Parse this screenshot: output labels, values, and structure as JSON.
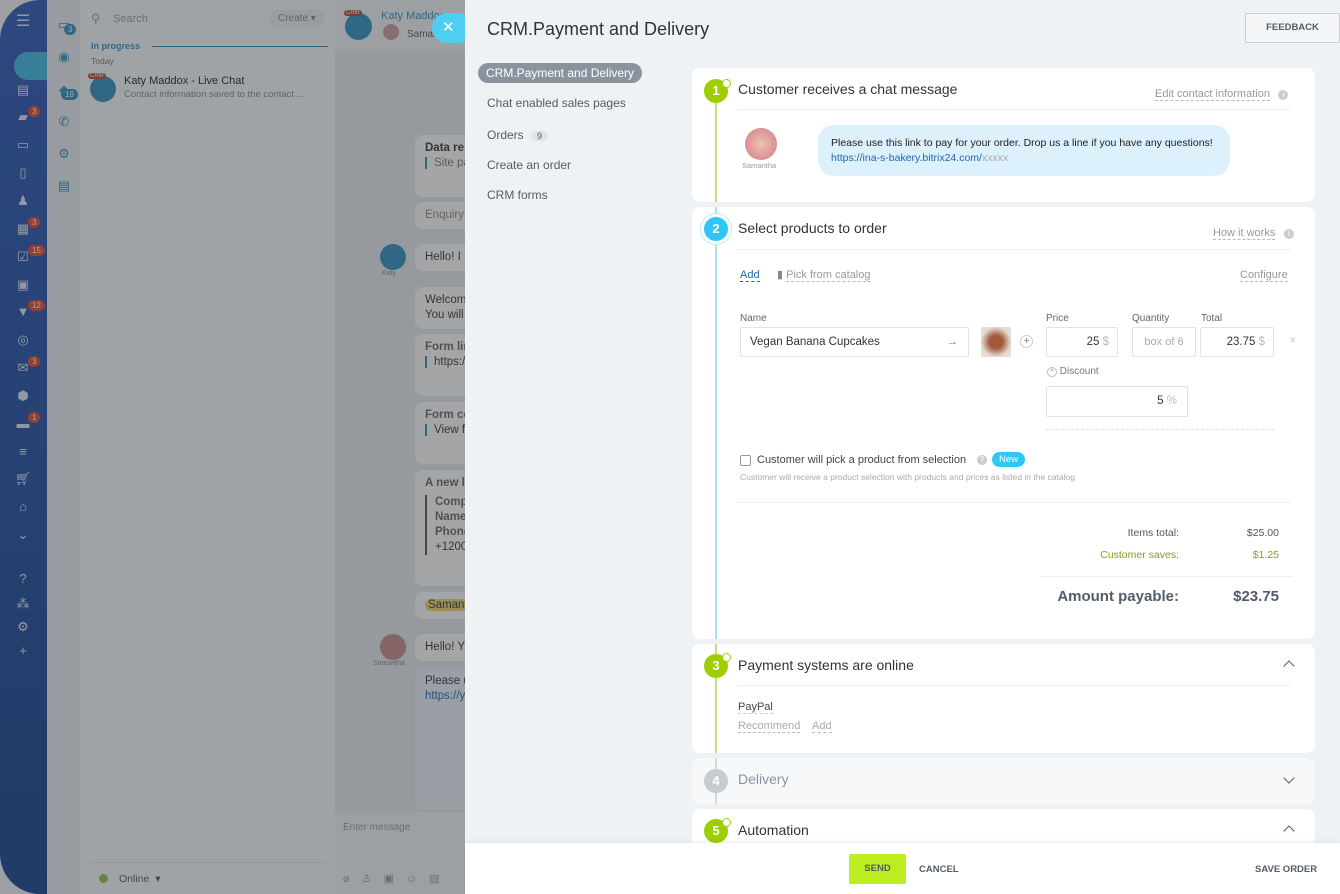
{
  "nav": {
    "badges": {
      "chat": "3",
      "calendar": "3",
      "tasks": "15",
      "crm": "12",
      "mail": "3",
      "robots": "1"
    }
  },
  "strip": {
    "badges": {
      "messages": "3",
      "openlines": "19"
    }
  },
  "list": {
    "search_placeholder": "Search",
    "create_label": "Create",
    "section": "In progress",
    "day": "Today",
    "items": [
      {
        "tag": "CRM",
        "title": "Katy Maddox - Live Chat",
        "preview": "Contact information saved to the contact ..."
      }
    ],
    "status": "Online"
  },
  "chat": {
    "tag": "CRM",
    "title": "Katy Maddox",
    "subtitle": "Samantha",
    "input_placeholder": "Enter message",
    "messages": [
      "Data re",
      "Site pa",
      "Enquiry",
      "Hello! I",
      "Welcom",
      "You will",
      "Form lin",
      "https:/",
      "Form co",
      "View f",
      "A new l",
      "Compl",
      "Name",
      "Phone",
      "+1200",
      "Saman",
      "Hello! Y",
      "Please u",
      "https://y"
    ],
    "avatars": {
      "katy": "Katy",
      "samantha": "Samantha"
    }
  },
  "panel": {
    "title": "CRM.Payment and Delivery",
    "feedback": "FEEDBACK",
    "menu": [
      {
        "label": "CRM.Payment and Delivery",
        "active": true
      },
      {
        "label": "Chat enabled sales pages"
      },
      {
        "label": "Orders",
        "count": "9"
      },
      {
        "label": "Create an order"
      },
      {
        "label": "CRM forms"
      }
    ],
    "step1": {
      "num": "1",
      "title": "Customer receives a chat message",
      "action": "Edit contact information",
      "sender": "Samantha",
      "message": "Please use this link to pay for your order. Drop us a line if you have any questions! ",
      "link": "https://ina-s-bakery.bitrix24.com/",
      "link_suffix": "xxxxx"
    },
    "step2": {
      "num": "2",
      "title": "Select products to order",
      "action": "How it works",
      "add": "Add",
      "catalog": "Pick from catalog",
      "configure": "Configure",
      "headers": {
        "name": "Name",
        "price": "Price",
        "quantity": "Quantity",
        "total": "Total"
      },
      "product": {
        "name": "Vegan Banana Cupcakes",
        "price": "25",
        "currency": "$",
        "quantity": "box of 6",
        "total": "23.75"
      },
      "discount_label": "Discount",
      "discount": "5",
      "discount_unit": "%",
      "selection_label": "Customer will pick a product from selection",
      "new_badge": "New",
      "selection_hint": "Customer will receive a product selection with products and prices as listed in the catalog",
      "items_total_label": "Items total:",
      "items_total": "$25.00",
      "saves_label": "Customer saves:",
      "saves": "$1.25",
      "payable_label": "Amount payable:",
      "payable": "$23.75"
    },
    "step3": {
      "num": "3",
      "title": "Payment systems are online",
      "system": "PayPal",
      "recommend": "Recommend",
      "add": "Add"
    },
    "step4": {
      "num": "4",
      "title": "Delivery"
    },
    "step5": {
      "num": "5",
      "title": "Automation"
    },
    "footer": {
      "send": "SEND",
      "cancel": "CANCEL",
      "save": "SAVE ORDER"
    }
  },
  "colors": {
    "accent_green": "#9dcf00",
    "accent_blue": "#2fc6f6",
    "link": "#2067b0",
    "save_green": "#80a02a"
  }
}
